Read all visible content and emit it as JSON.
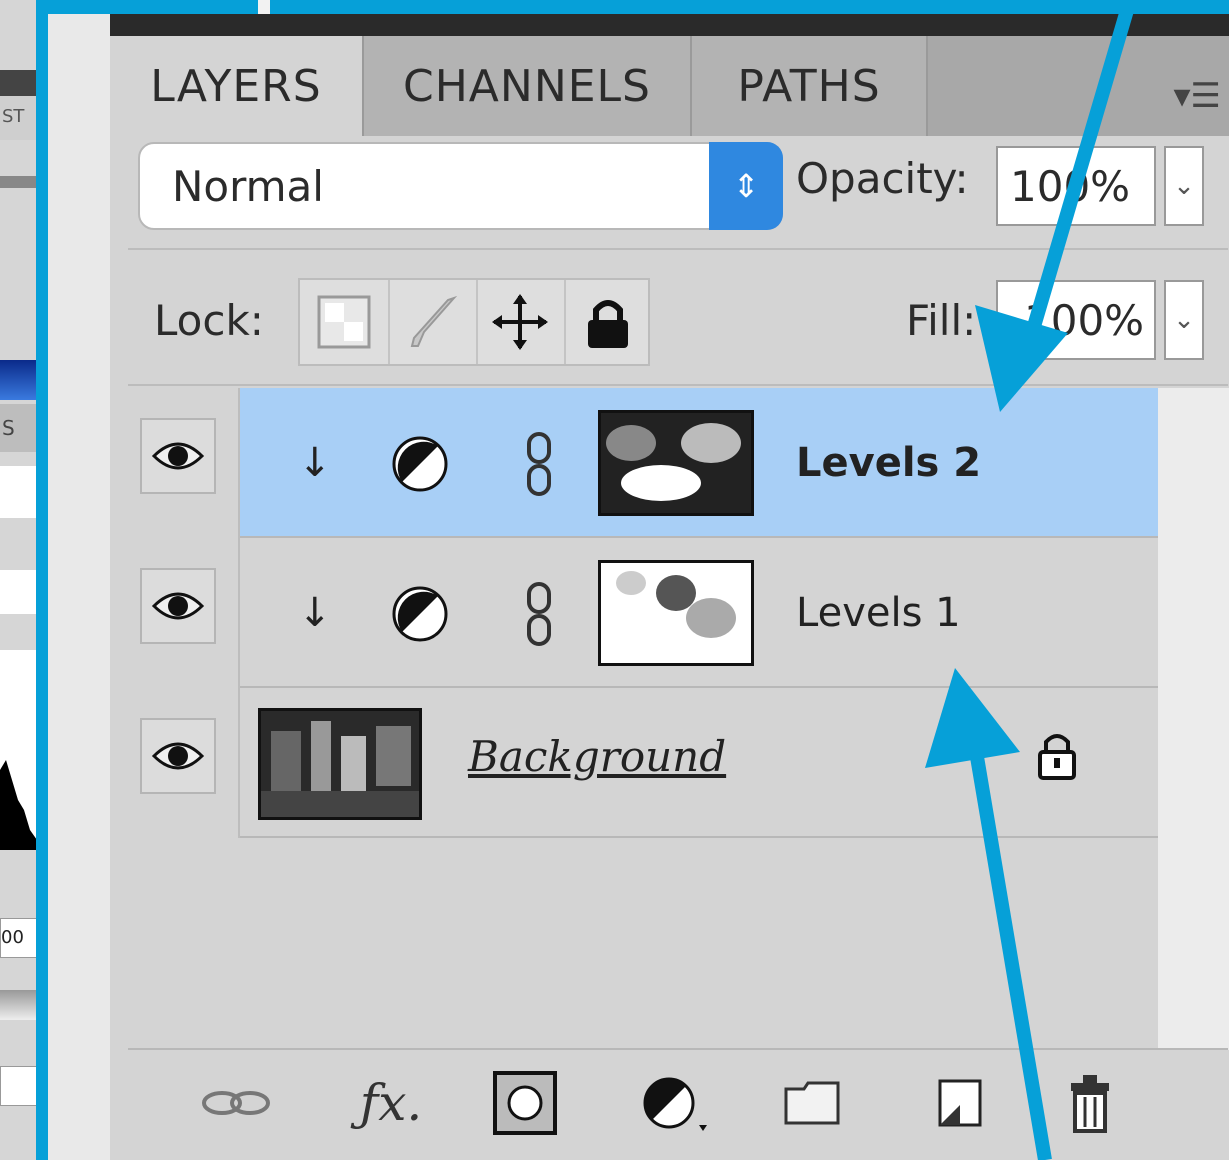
{
  "left_panel": {
    "cut_text_top": "ST",
    "cut_tab_text": "S",
    "cut_value": "00"
  },
  "tabs": [
    {
      "label": "LAYERS",
      "active": true
    },
    {
      "label": "CHANNELS",
      "active": false
    },
    {
      "label": "PATHS",
      "active": false
    }
  ],
  "panel_menu_icon": "panel-menu-icon",
  "blend_mode": {
    "value": "Normal"
  },
  "opacity": {
    "label": "Opacity:",
    "value": "100%"
  },
  "lock": {
    "label": "Lock:",
    "icons": [
      "transparent-pixels-lock-icon",
      "brush-lock-icon",
      "move-lock-icon",
      "padlock-icon"
    ]
  },
  "fill": {
    "label": "Fill:",
    "value": "100%"
  },
  "layers": [
    {
      "name": "Levels 2",
      "selected": true,
      "type": "adjustment"
    },
    {
      "name": "Levels 1",
      "selected": false,
      "type": "adjustment"
    },
    {
      "name": "Background",
      "selected": false,
      "type": "image",
      "locked": true
    }
  ],
  "footer_icons": [
    "link-icon",
    "fx-icon",
    "mask-icon",
    "adjustment-icon",
    "folder-icon",
    "new-layer-icon",
    "trash-icon"
  ],
  "colors": {
    "frame_accent": "#06a0d8",
    "selected_row": "#a8cff6",
    "panel_bg": "#d4d4d4",
    "blend_arrows": "#2f88e0"
  }
}
